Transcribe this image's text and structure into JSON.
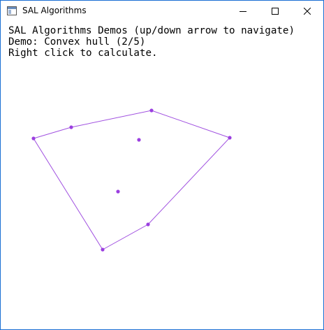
{
  "window": {
    "title": "SAL Algorithms",
    "icon": "app-window-icon",
    "controls": {
      "minimize": "minimize-icon",
      "maximize": "maximize-icon",
      "close": "close-icon"
    }
  },
  "content": {
    "line1": "SAL Algorithms Demos (up/down arrow to navigate)",
    "line2": "Demo: Convex hull (2/5)",
    "line3": "Right click to calculate."
  },
  "colors": {
    "accent": "#a050e0",
    "point": "#9b3fe0",
    "border": "#1a6fd3"
  }
}
